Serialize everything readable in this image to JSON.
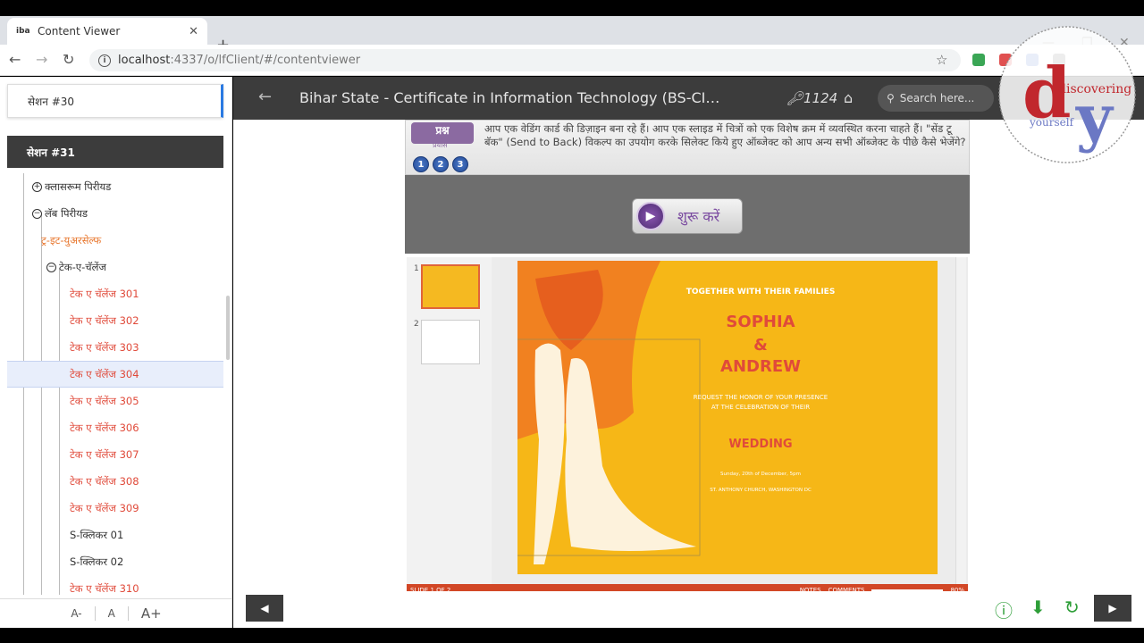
{
  "browser": {
    "tab_title": "Content Viewer",
    "tab_favicon": "iba",
    "url_host": "localhost",
    "url_path": ":4337/o/lfClient/#/contentviewer"
  },
  "header": {
    "title": "Bihar State - Certificate in Information Technology (BS-CI…",
    "key_count": "1124",
    "search_placeholder": "Search here..."
  },
  "sidebar": {
    "session_top": "सेशन #30",
    "session_active": "सेशन #31",
    "items": [
      {
        "label": "क्लासरूम पिरीयड",
        "toggle": "+",
        "style": "normal"
      },
      {
        "label": "लॅब पिरीयड",
        "toggle": "−",
        "style": "normal"
      },
      {
        "label": "ट्र-इट-युअरसेल्फ",
        "toggle": "",
        "style": "orange"
      },
      {
        "label": "टेक-ए-चॅलेंज",
        "toggle": "−",
        "style": "normal"
      },
      {
        "label": "टेक ए चॅलेंज 301",
        "toggle": "",
        "style": "red"
      },
      {
        "label": "टेक ए चॅलेंज 302",
        "toggle": "",
        "style": "red"
      },
      {
        "label": "टेक ए चॅलेंज 303",
        "toggle": "",
        "style": "red"
      },
      {
        "label": "टेक ए चॅलेंज 304",
        "toggle": "",
        "style": "red"
      },
      {
        "label": "टेक ए चॅलेंज 305",
        "toggle": "",
        "style": "red"
      },
      {
        "label": "टेक ए चॅलेंज 306",
        "toggle": "",
        "style": "red"
      },
      {
        "label": "टेक ए चॅलेंज 307",
        "toggle": "",
        "style": "red"
      },
      {
        "label": "टेक ए चॅलेंज 308",
        "toggle": "",
        "style": "red"
      },
      {
        "label": "टेक ए चॅलेंज 309",
        "toggle": "",
        "style": "red"
      },
      {
        "label": "S-क्लिकर 01",
        "toggle": "",
        "style": "normal"
      },
      {
        "label": "S-क्लिकर 02",
        "toggle": "",
        "style": "normal"
      },
      {
        "label": "टेक ए चॅलेंज 310",
        "toggle": "",
        "style": "red"
      }
    ],
    "font_controls": [
      "A-",
      "A",
      "A+"
    ]
  },
  "question": {
    "badge": "प्रश्न",
    "sub": "प्रयास",
    "numbers": [
      "1",
      "2",
      "3"
    ],
    "text": "आप एक वेडिंग कार्ड की डिज़ाइन बना रहे हैं। आप एक स्लाइड में चित्रों को एक विशेष क्रम में व्यवस्थित करना चाहते हैं। \"सेंड टू बॅक\" (Send to Back) विकल्प का उपयोग करके सिलेक्ट किये हुए ऑब्जेक्ट को आप अन्य सभी ऑब्जेक्ट के पीछे कैसे भेजेंगे?",
    "start_label": "शुरू करें"
  },
  "slide": {
    "line1": "TOGETHER WITH THEIR FAMILIES",
    "name1": "SOPHIA",
    "amp": "&",
    "name2": "ANDREW",
    "request": "REQUEST THE HONOR OF YOUR PRESENCE AT THE CELEBRATION OF THEIR",
    "wedding": "WEDDING",
    "date": "Sunday, 20th of December, 5pm",
    "venue": "ST. ANTHONY CHURCH, WASHINGTON DC",
    "status_left": "SLIDE 1 OF 2",
    "notes": "NOTES",
    "comments": "COMMENTS",
    "zoom": "80%"
  },
  "logo": {
    "word": "discovering",
    "word2": "yourself"
  },
  "colors": {
    "header_bg": "#3c3c3c",
    "slide_yellow": "#f6b717",
    "accent_red": "#e04a3a",
    "accent_orange": "#e8772e",
    "nav_green": "#2e9e38",
    "ppt_status": "#d24726"
  }
}
